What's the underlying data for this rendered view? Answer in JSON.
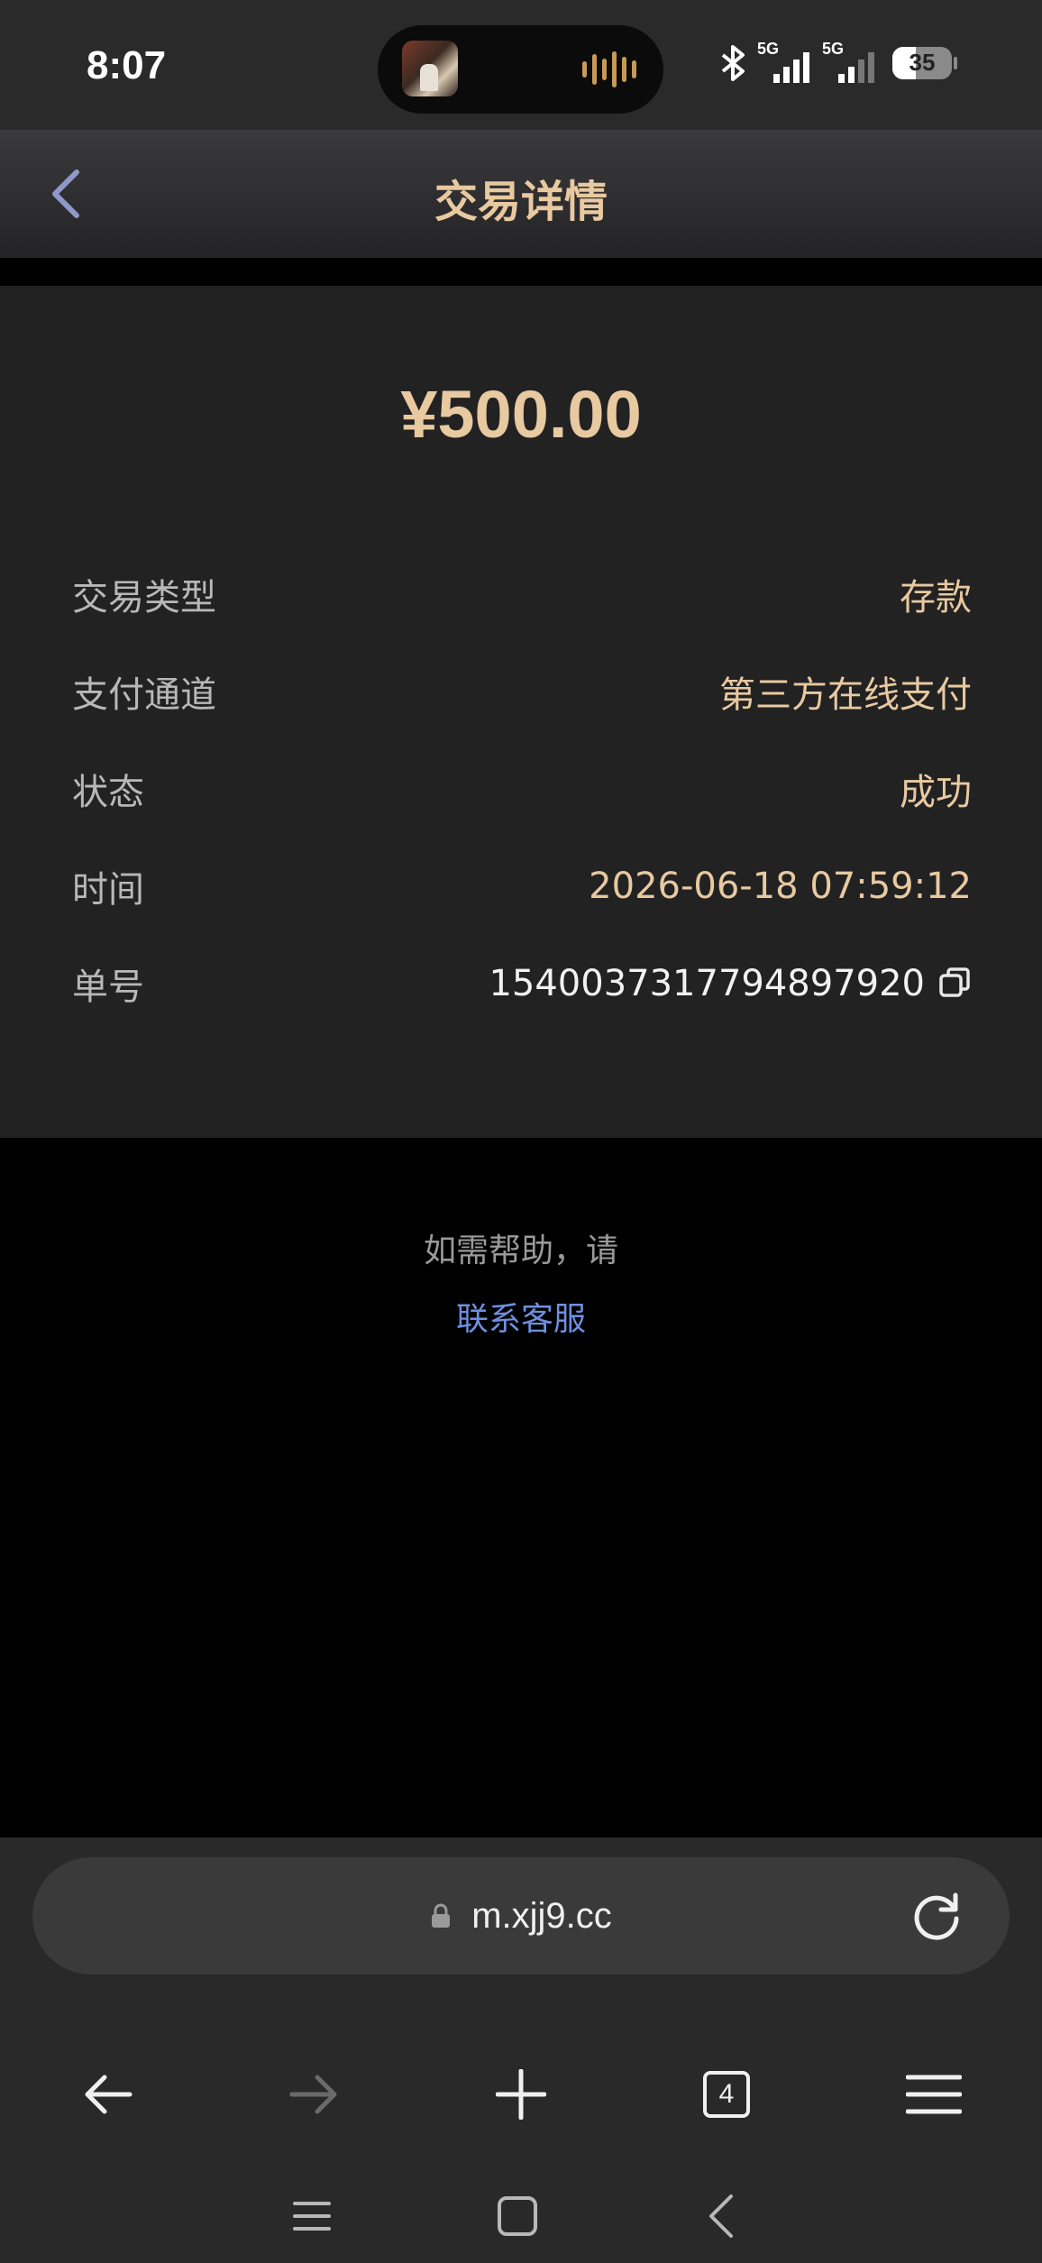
{
  "status_bar": {
    "time": "8:07",
    "network1": "5G",
    "network2": "5G",
    "battery": "35",
    "battery_level": 0.35
  },
  "header": {
    "title": "交易详情",
    "back_icon": "chevron-left-icon"
  },
  "transaction": {
    "amount": "¥500.00",
    "rows": [
      {
        "key": "交易类型",
        "value": "存款"
      },
      {
        "key": "支付通道",
        "value": "第三方在线支付"
      },
      {
        "key": "状态",
        "value": "成功"
      },
      {
        "key": "时间",
        "value": "2026-06-18 07:59:12"
      },
      {
        "key": "单号",
        "value": "1540037317794897920"
      }
    ],
    "copy_icon": "copy-icon"
  },
  "help": {
    "text": "如需帮助，请",
    "link": "联系客服"
  },
  "browser": {
    "url": "m.xjj9.cc",
    "tab_count": "4",
    "icons": [
      "back-arrow-icon",
      "forward-arrow-icon",
      "plus-icon",
      "tabs-icon",
      "menu-icon",
      "reload-icon",
      "lock-icon"
    ]
  },
  "colors": {
    "accent_gold": "#e8c9a0",
    "link_blue": "#6f8fe0",
    "card_bg": "#222223",
    "page_bg": "#000000"
  }
}
